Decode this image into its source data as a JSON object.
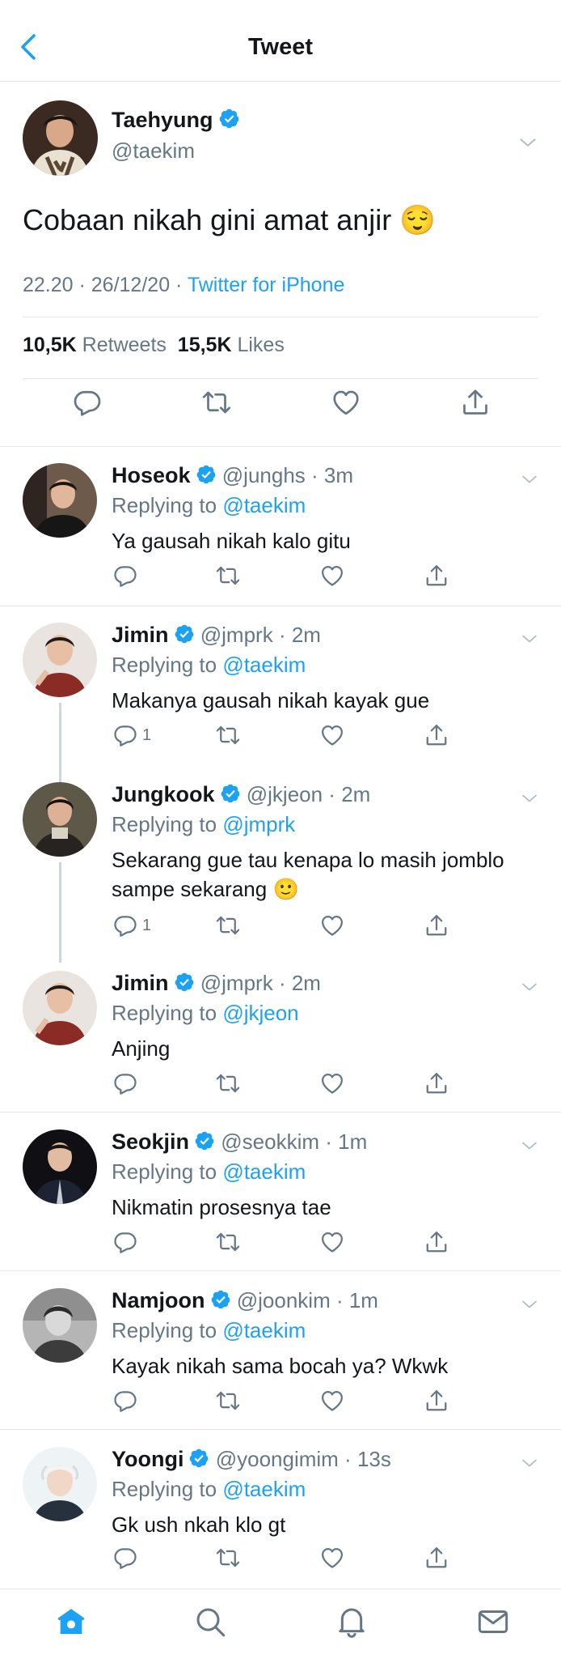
{
  "header": {
    "title": "Tweet"
  },
  "tweet": {
    "name": "Taehyung",
    "handle": "@taekim",
    "text": "Cobaan nikah gini amat anjir 😌",
    "time": "22.20 · 26/12/20 · ",
    "source": "Twitter for iPhone",
    "retweets_count": "10,5K",
    "retweets_label": "Retweets",
    "likes_count": "15,5K",
    "likes_label": "Likes"
  },
  "replies": [
    {
      "name": "Hoseok",
      "handle": "@junghs",
      "time": "3m",
      "replying_label": "Replying to",
      "replying_to": "@taekim",
      "text": "Ya gausah nikah kalo gitu",
      "reply_count": ""
    },
    {
      "name": "Jimin",
      "handle": "@jmprk",
      "time": "2m",
      "replying_label": "Replying to",
      "replying_to": "@taekim",
      "text": "Makanya gausah nikah kayak gue",
      "reply_count": "1"
    },
    {
      "name": "Jungkook",
      "handle": "@jkjeon",
      "time": "2m",
      "replying_label": "Replying to",
      "replying_to": "@jmprk",
      "text": "Sekarang gue tau kenapa lo masih jomblo sampe sekarang 🙂",
      "reply_count": "1"
    },
    {
      "name": "Jimin",
      "handle": "@jmprk",
      "time": "2m",
      "replying_label": "Replying to",
      "replying_to": "@jkjeon",
      "text": "Anjing",
      "reply_count": ""
    },
    {
      "name": "Seokjin",
      "handle": "@seokkim",
      "time": "1m",
      "replying_label": "Replying to",
      "replying_to": "@taekim",
      "text": "Nikmatin prosesnya tae",
      "reply_count": ""
    },
    {
      "name": "Namjoon",
      "handle": "@joonkim",
      "time": "1m",
      "replying_label": "Replying to",
      "replying_to": "@taekim",
      "text": "Kayak nikah sama bocah ya? Wkwk",
      "reply_count": ""
    },
    {
      "name": "Yoongi",
      "handle": "@yoongimim",
      "time": "13s",
      "replying_label": "Replying to",
      "replying_to": "@taekim",
      "text": "Gk ush nkah klo gt",
      "reply_count": ""
    }
  ],
  "colors": {
    "accent": "#1da1f2",
    "muted": "#657786",
    "border": "#e1e8ed"
  },
  "tabbar": {
    "items": [
      "home-icon",
      "search-icon",
      "notifications-icon",
      "messages-icon"
    ],
    "active": "home-icon"
  }
}
